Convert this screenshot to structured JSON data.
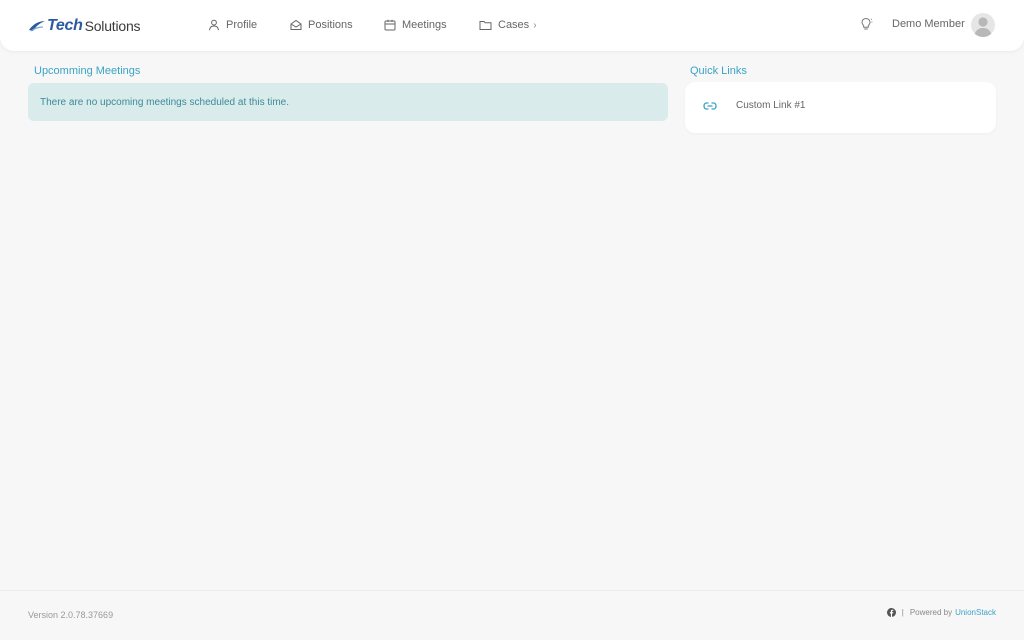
{
  "header": {
    "logo": {
      "bold": "Tech",
      "regular": "Solutions"
    },
    "nav": [
      {
        "label": "Profile",
        "icon": "user-icon"
      },
      {
        "label": "Positions",
        "icon": "envelope-open-icon"
      },
      {
        "label": "Meetings",
        "icon": "calendar-icon"
      },
      {
        "label": "Cases",
        "icon": "folder-icon",
        "chevron": "›"
      }
    ],
    "user": {
      "name": "Demo Member",
      "icon": "lightbulb-icon"
    }
  },
  "meetings": {
    "title": "Upcomming Meetings",
    "empty_message": "There are no upcoming meetings scheduled at this time."
  },
  "quick_links": {
    "title": "Quick Links",
    "items": [
      {
        "label": "Custom Link #1",
        "icon": "link-icon"
      }
    ]
  },
  "footer": {
    "version": "Version 2.0.78.37669",
    "separator": "|",
    "powered_by": "Powered by",
    "powered_link": "UnionStack"
  },
  "colors": {
    "accent": "#3aa3c5",
    "alert_bg": "#d9ebeb",
    "alert_text": "#3b8b9a",
    "logo_blue": "#2c5aa0"
  }
}
